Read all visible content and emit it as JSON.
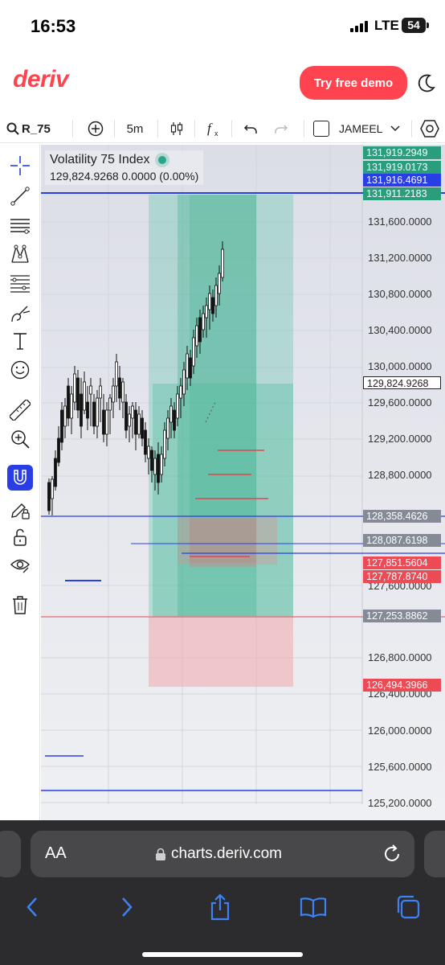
{
  "status_bar": {
    "time": "16:53",
    "network": "LTE",
    "battery": "54"
  },
  "header": {
    "logo": "deriv",
    "demo_button": "Try free demo",
    "theme_icon": "moon-icon"
  },
  "toolbar": {
    "symbol": "R_75",
    "add_icon": "plus-circle-icon",
    "interval": "5m",
    "chart_type_icon": "candles-icon",
    "indicators_icon": "fx-icon",
    "undo_icon": "undo-icon",
    "redo_icon": "redo-icon",
    "drawings_checkbox_label": "JAMEEL",
    "settings_icon": "settings-hex-icon"
  },
  "left_tools": [
    "crosshair-icon",
    "line-icon",
    "horizontal-lines-icon",
    "pattern-icon",
    "channel-icon",
    "brush-icon",
    "text-icon",
    "emoji-icon",
    "ruler-icon",
    "zoom-icon",
    "magnet-icon",
    "lock-drawing-icon",
    "unlock-icon",
    "eye-icon",
    "trash-icon"
  ],
  "chart": {
    "symbol_name": "Volatility 75 Index",
    "last_price_line": "129,824.9268  0.0000 (0.00%)",
    "status_dot_color": "#2aa68a",
    "axis_labels": [
      "131,600.0000",
      "131,200.0000",
      "130,800.0000",
      "130,400.0000",
      "130,000.0000",
      "129,600.0000",
      "129,200.0000",
      "128,800.0000",
      "127,600.0000",
      "126,800.0000",
      "126,400.0000",
      "126,000.0000",
      "125,600.0000",
      "125,200.0000"
    ],
    "price_tags": [
      {
        "value": "131,919.2949",
        "color": "#2a9d7d"
      },
      {
        "value": "131,919.0173",
        "color": "#2a9d7d"
      },
      {
        "value": "131,916.4691",
        "color": "#2a3ee5"
      },
      {
        "value": "131,911.2183",
        "color": "#2a9d7d"
      },
      {
        "value": "129,824.9268",
        "color": "#ffffff"
      },
      {
        "value": "128,358.4626",
        "color": "#858a96"
      },
      {
        "value": "128,087.6198",
        "color": "#858a96"
      },
      {
        "value": "127,851.5604",
        "color": "#ec4a55"
      },
      {
        "value": "127,787.8740",
        "color": "#ec4a55"
      },
      {
        "value": "127,253.8862",
        "color": "#858a96"
      },
      {
        "value": "126,494.3966",
        "color": "#ec4a55"
      }
    ]
  },
  "browser": {
    "text_size_label": "AA",
    "url": "charts.deriv.com",
    "nav": [
      "back-icon",
      "forward-icon",
      "share-icon",
      "bookmarks-icon",
      "tabs-icon"
    ]
  }
}
